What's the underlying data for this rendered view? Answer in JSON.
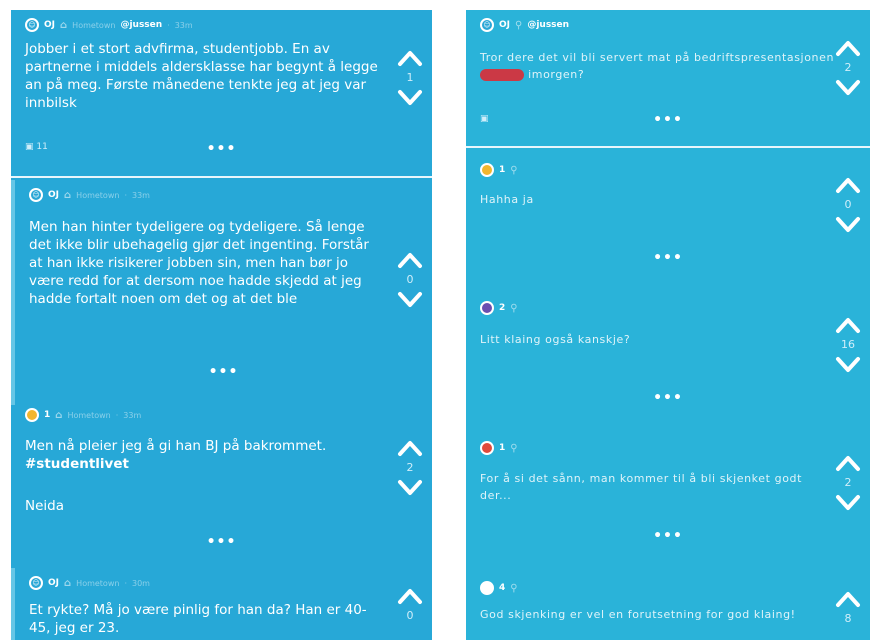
{
  "left": {
    "posts": [
      {
        "user": "OJ",
        "location": "Hometown",
        "handle": "@jussen",
        "time": "33m",
        "text": "Jobber i et stort advfirma, studentjobb. En av partnerne i middels aldersklasse har begynt å legge an på meg. Første månedene tenkte jeg at jeg var innbilsk",
        "votes": "1",
        "reply_icon": "11"
      },
      {
        "user": "OJ",
        "location": "Hometown",
        "time": "33m",
        "text": "Men han hinter tydeligere og tydeligere. Så lenge det ikke blir ubehagelig gjør det ingenting. Forstår at han ikke risikerer jobben sin, men han bør jo være redd for at dersom noe hadde skjedd at jeg hadde fortalt noen om det og at det ble",
        "votes": "0"
      },
      {
        "user": "1",
        "location": "Hometown",
        "time": "33m",
        "text_main": "Men nå pleier jeg å gi han BJ på bakrommet. ",
        "hashtag": "#studentlivet",
        "text_extra": "Neida",
        "votes": "2"
      },
      {
        "user": "OJ",
        "location": "Hometown",
        "time": "30m",
        "text": "Et rykte? Må jo være pinlig for han da? Han er 40-45, jeg er 23.",
        "votes": "0"
      }
    ]
  },
  "right": {
    "op": {
      "user": "OJ",
      "handle": "@jussen",
      "text_before": "Tror dere det vil bli servert mat på bedriftspresentasjonen ",
      "text_after": " imorgen?",
      "votes": "2"
    },
    "replies": [
      {
        "user": "1",
        "text": "Hahha ja",
        "votes": "0",
        "badge": "yellow"
      },
      {
        "user": "2",
        "text": "Litt klaing også kanskje?",
        "votes": "16",
        "badge": "purple"
      },
      {
        "user": "1",
        "text": "For å si det sånn, man kommer til å bli skjenket godt der...",
        "votes": "2",
        "badge": "red"
      },
      {
        "user": "4",
        "text": "God skjenking er vel en forutsetning for god klaing!",
        "votes": "8",
        "badge": "white"
      }
    ]
  },
  "ui": {
    "more_dots": "•••"
  },
  "colors": {
    "bg_left": "#27a8d7",
    "bg_right": "#2ab3d9",
    "redaction": "#e8242c"
  }
}
